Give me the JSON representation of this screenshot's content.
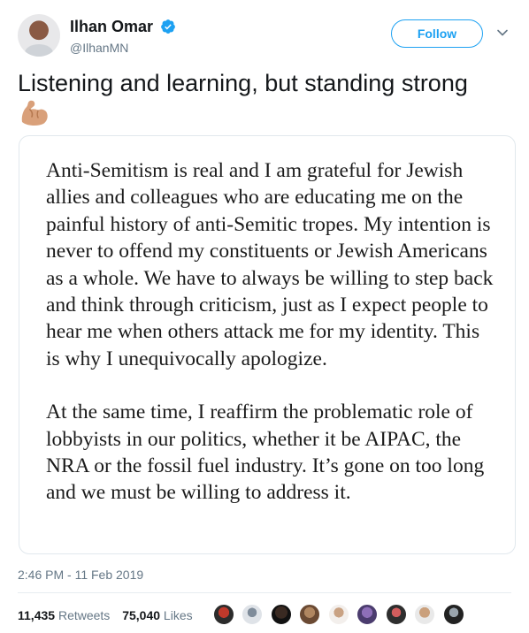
{
  "author": {
    "display_name": "Ilhan Omar",
    "handle": "@IlhanMN",
    "verified_icon": "verified-badge-icon"
  },
  "follow_label": "Follow",
  "tweet_text": "Listening and learning, but standing strong",
  "emoji": "flexed-biceps-emoji",
  "statement": {
    "paragraph_1": "Anti-Semitism is real and I am grateful for Jewish allies and colleagues who are educating me on the painful history of anti-Semitic tropes. My intention is never to offend my constituents or Jewish Americans as a whole. We have to always be willing to step back and think through criticism, just as I expect people to hear me when others attack me for my identity. This is why I unequivocally apologize.",
    "paragraph_2": "At the same time, I reaffirm the problematic role of lobbyists in our politics, whether it be AIPAC, the NRA or the fossil fuel industry. It’s gone on too long and we must be willing to address it."
  },
  "timestamp": "2:46 PM - 11 Feb 2019",
  "stats": {
    "retweets_count": "11,435",
    "retweets_label": "Retweets",
    "likes_count": "75,040",
    "likes_label": "Likes"
  },
  "colors": {
    "accent": "#1da1f2",
    "secondary_text": "#657786",
    "border": "#e1e8ed"
  }
}
